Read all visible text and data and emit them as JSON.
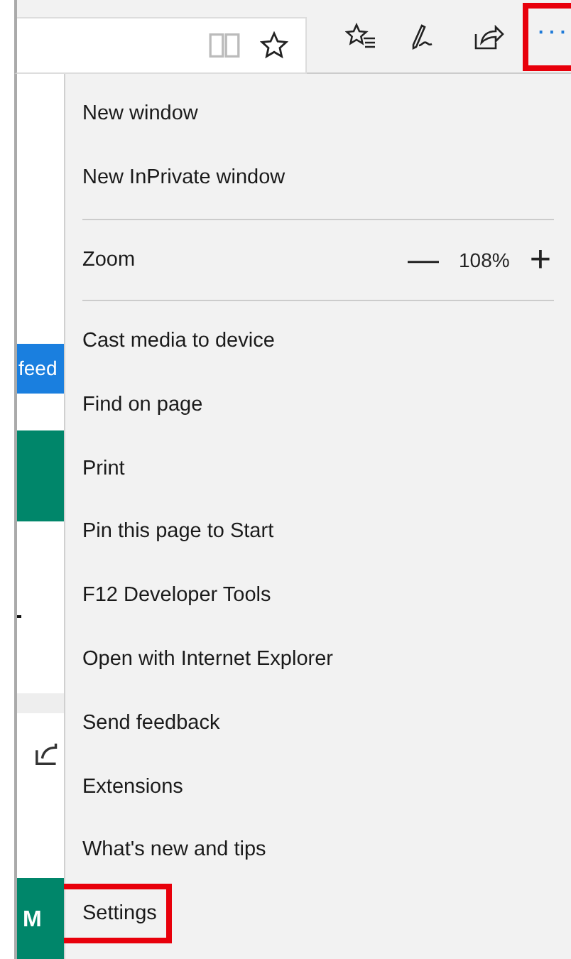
{
  "page": {
    "link_text": "feed",
    "banner_text": "M"
  },
  "toolbar": {
    "more_button": {
      "label": "···",
      "highlighted": true
    }
  },
  "menu": [
    {
      "kind": "item",
      "label": "New window",
      "highlighted": false
    },
    {
      "kind": "item",
      "label": "New InPrivate window",
      "highlighted": false
    },
    {
      "kind": "divider"
    },
    {
      "kind": "zoom",
      "label": "Zoom",
      "minus": "—",
      "value": "108%",
      "plus": "+"
    },
    {
      "kind": "divider"
    },
    {
      "kind": "item",
      "label": "Cast media to device",
      "highlighted": false
    },
    {
      "kind": "item",
      "label": "Find on page",
      "highlighted": false
    },
    {
      "kind": "item",
      "label": "Print",
      "highlighted": false
    },
    {
      "kind": "item",
      "label": "Pin this page to Start",
      "highlighted": false
    },
    {
      "kind": "item",
      "label": "F12 Developer Tools",
      "highlighted": false
    },
    {
      "kind": "item",
      "label": "Open with Internet Explorer",
      "highlighted": false
    },
    {
      "kind": "item",
      "label": "Send feedback",
      "highlighted": false
    },
    {
      "kind": "item",
      "label": "Extensions",
      "highlighted": false
    },
    {
      "kind": "item",
      "label": "What's new and tips",
      "highlighted": false
    },
    {
      "kind": "item",
      "label": "Settings",
      "highlighted": true
    }
  ]
}
